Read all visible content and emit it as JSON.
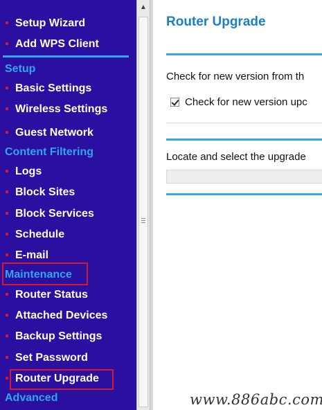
{
  "sidebar": {
    "items": [
      {
        "label": "Setup Wizard"
      },
      {
        "label": "Add WPS Client"
      },
      {
        "section": "Setup"
      },
      {
        "label": "Basic Settings"
      },
      {
        "label": "Wireless Settings"
      },
      {
        "label": "Guest Network"
      },
      {
        "section": "Content Filtering"
      },
      {
        "label": "Logs"
      },
      {
        "label": "Block Sites"
      },
      {
        "label": "Block Services"
      },
      {
        "label": "Schedule"
      },
      {
        "label": "E-mail"
      },
      {
        "section": "Maintenance",
        "highlighted": true
      },
      {
        "label": "Router Status"
      },
      {
        "label": "Attached Devices"
      },
      {
        "label": "Backup Settings"
      },
      {
        "label": "Set Password"
      },
      {
        "label": "Router Upgrade",
        "highlighted": true
      },
      {
        "section": "Advanced"
      }
    ]
  },
  "main": {
    "title": "Router Upgrade",
    "check_text": "Check for new version from th",
    "checkbox": {
      "label": "Check for new version upc",
      "checked": true
    },
    "locate_text": "Locate and select the upgrade"
  },
  "watermark": "www.886abc.com",
  "colors": {
    "sidebar_bg": "#2a0fa0",
    "section_heading": "#2fa6ee",
    "bullet": "#d8182c",
    "highlight_box": "#d8182c",
    "title": "#1b7fc8"
  },
  "icons": {
    "scroll_up": "scroll-up-arrow-icon",
    "thumb_grip": "scroll-grip-icon"
  }
}
